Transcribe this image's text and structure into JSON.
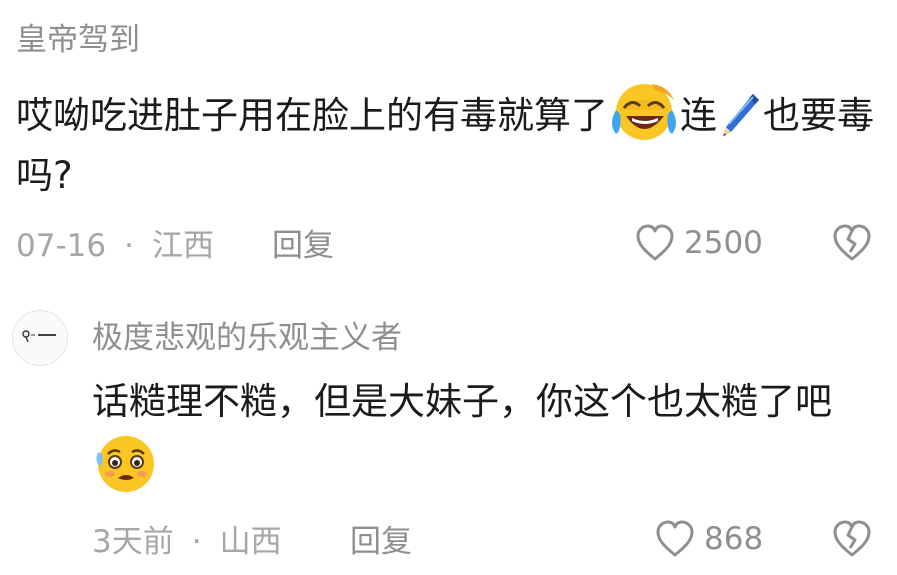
{
  "comments": [
    {
      "username": "皇帝驾到",
      "text_part1": "哎呦吃进肚子用在脸上的有毒就算了",
      "emoji1": "laughing-crying-emoji",
      "text_part2": "连",
      "emoji2": "pen-emoji",
      "text_part3": "也要毒吗?",
      "date": "07-16",
      "separator": "·",
      "location": "江西",
      "reply_label": "回复",
      "likes": "2500"
    },
    {
      "username": "极度悲观的乐观主义者",
      "avatar_icon": "avatar-icon",
      "text_part1": "话糙理不糙，但是大妹子，你这个也太糙了吧",
      "emoji1": "pleading-sweat-emoji",
      "date": "3天前",
      "separator": "·",
      "location": "山西",
      "reply_label": "回复",
      "likes": "868"
    }
  ],
  "colors": {
    "username": "#8f8f8f",
    "text": "#1b1b1b",
    "meta": "#a6a6a6",
    "icon": "#8f8f8f"
  }
}
